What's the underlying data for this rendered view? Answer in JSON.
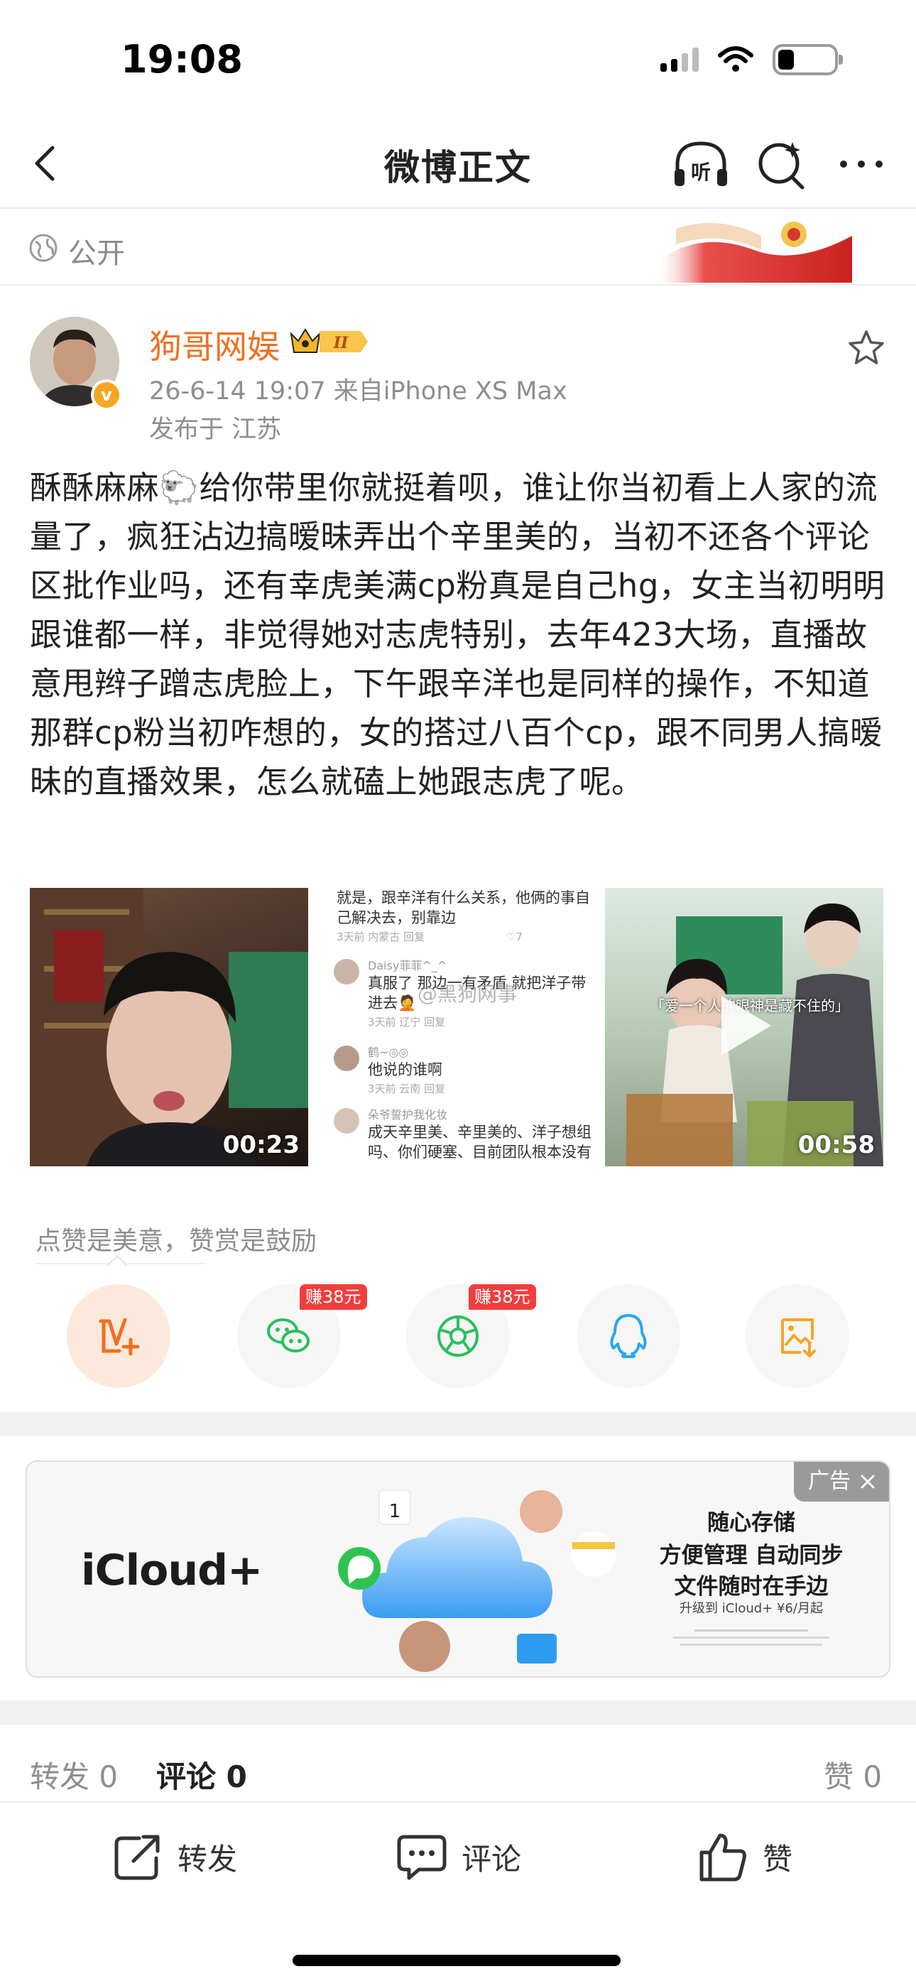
{
  "status_bar": {
    "time": "19:08"
  },
  "nav": {
    "title": "微博正文"
  },
  "visibility": {
    "label": "公开"
  },
  "post": {
    "author": "狗哥网娱",
    "vip_level": "II",
    "meta": "26-6-14 19:07  来自iPhone XS Max",
    "location": "发布于 江苏",
    "text": "酥酥麻麻🐑给你带里你就挺着呗，谁让你当初看上人家的流量了，疯狂沾边搞暧昧弄出个辛里美的，当初不还各个评论区批作业吗，还有幸虎美满cp粉真是自己hg，女主当初明明跟谁都一样，非觉得她对志虎特别，去年423大场，直播故意甩辫子蹭志虎脸上，下午跟辛洋也是同样的操作，不知道那群cp粉当初咋想的，女的搭过八百个cp，跟不同男人搞暧昧的直播效果，怎么就磕上她跟志虎了呢。",
    "media": [
      {
        "type": "video",
        "duration": "00:23"
      },
      {
        "type": "image",
        "watermark": "@黑狗网事",
        "comments": [
          {
            "name": "",
            "text": "就是，跟辛洋有什么关系，他俩的事自己解决去，别靠边",
            "meta": "3天前 内蒙古    回复",
            "likes": "7"
          },
          {
            "name": "Daisy菲菲^_^",
            "text": "真服了 那边一有矛盾 就把洋子带进去🤦",
            "meta": "3天前 辽宁    回复",
            "likes": ""
          },
          {
            "name": "鹤~◎◎",
            "text": "他说的谁啊",
            "meta": "3天前 云南    回复",
            "likes": ""
          },
          {
            "name": "朵爷誓护我化妆",
            "text": "成天辛里美、辛里美的、洋子想组吗、你们硬塞、目前团队根本没有",
            "meta": "",
            "likes": ""
          }
        ]
      },
      {
        "type": "video",
        "duration": "00:58",
        "caption": "「爱一个人的眼神是藏不住的」"
      }
    ]
  },
  "reward": {
    "hint": "点赞是美意，赞赏是鼓励",
    "share_targets": [
      {
        "icon": "reward-v-plus-icon",
        "badge": ""
      },
      {
        "icon": "wechat-icon",
        "badge": "赚38元"
      },
      {
        "icon": "moments-icon",
        "badge": "赚38元"
      },
      {
        "icon": "qq-icon",
        "badge": ""
      },
      {
        "icon": "save-image-icon",
        "badge": ""
      }
    ]
  },
  "ad": {
    "tag": "广告",
    "brand": "iCloud+",
    "line1": "随心存储",
    "line2": "方便管理 自动同步",
    "line3": "文件随时在手边",
    "small": "升级到 iCloud+ ¥6/月起",
    "calendar_day": "1"
  },
  "stats": {
    "repost_label": "转发",
    "repost_count": "0",
    "comment_label": "评论",
    "comment_count": "0",
    "like_label": "赞",
    "like_count": "0"
  },
  "actions": {
    "repost": "转发",
    "comment": "评论",
    "like": "赞"
  },
  "colors": {
    "accent": "#f26e21",
    "badge_red": "#f23d3d",
    "wechat_green": "#2bbf5c",
    "qq_blue": "#27a7f0",
    "gold": "#f5a623"
  }
}
